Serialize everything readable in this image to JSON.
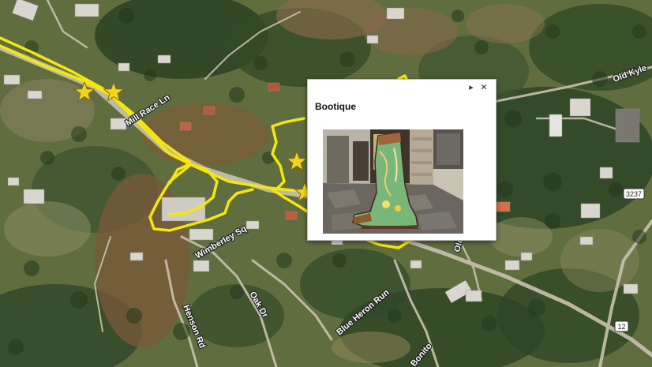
{
  "map": {
    "road_labels": [
      "Mill Race Ln",
      "Wimberley Sq",
      "Oak Dr",
      "Henson Rd",
      "Blue Heron Run",
      "Old Kyle",
      "Bonito",
      "Old"
    ],
    "shields": [
      "3237",
      "12"
    ]
  },
  "popup": {
    "title": "Bootique",
    "next_symbol": "▸",
    "close_symbol": "✕"
  },
  "markers": {
    "icon": "star-icon",
    "color": "#f2d41c",
    "count": 4
  },
  "track": {
    "color": "#f5e60e"
  }
}
